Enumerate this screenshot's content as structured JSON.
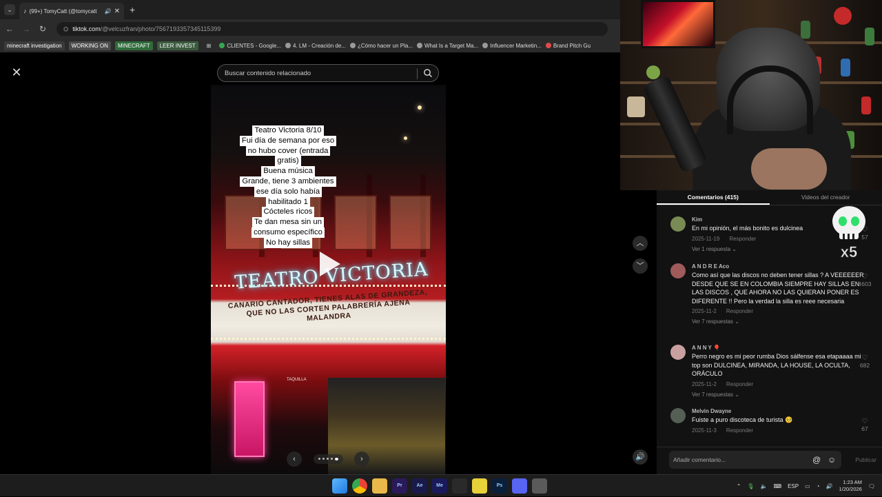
{
  "browser": {
    "tab": {
      "title": "(99+) TomyCatt (@tomycatt",
      "favicon": "tiktok"
    },
    "url": {
      "host": "tiktok.com",
      "path": "/@velcuzfran/photo/7567193357345115399"
    },
    "bookmarks": [
      {
        "label": "minecraft investigation",
        "type": "tag",
        "color": "#3a3a3a"
      },
      {
        "label": "WORKING ON",
        "type": "tag",
        "color": "#4a4a4a"
      },
      {
        "label": "MINECRAFT",
        "type": "tag",
        "color": "#2f6b3a"
      },
      {
        "label": "LEER INVEST",
        "type": "tag",
        "color": "#3b5a3e"
      },
      {
        "label": "CLIENTES - Google...",
        "type": "link",
        "color": "#34a853"
      },
      {
        "label": "4. LM - Creación de...",
        "type": "link",
        "color": "#9a9a9a"
      },
      {
        "label": "¿Cómo hacer un Pla...",
        "type": "link",
        "color": "#9a9a9a"
      },
      {
        "label": "What Is a Target Ma...",
        "type": "link",
        "color": "#9a9a9a"
      },
      {
        "label": "Influencer Marketin...",
        "type": "link",
        "color": "#9a9a9a"
      },
      {
        "label": "Brand Pitch Gu",
        "type": "link",
        "color": "#e24a4a"
      }
    ]
  },
  "search": {
    "placeholder": "Buscar contenido relacionado"
  },
  "photo": {
    "overlay_lines": [
      "Teatro Victoria 8/10",
      "Fui día de semana por eso",
      "no hubo cover (entrada",
      "gratis)",
      "Buena música",
      "Grande, tiene 3 ambientes",
      "ese día solo había",
      "habilitado 1",
      "Cócteles ricos",
      "Te dan mesa sin un",
      "consumo específico",
      "No hay sillas"
    ],
    "sign": "TEATRO VICTORIA",
    "marquee_lines": [
      "CANARIO CANTADOR, TIENES ALAS DE GRANDEZA,",
      "QUE NO LAS CORTEN PALABRERÍA AJENA",
      "MALANDRA"
    ],
    "door_label": "TAQUILLA",
    "carousel": {
      "count": 5,
      "active": 4
    }
  },
  "comments_panel": {
    "tabs": [
      "Comentarios (415)",
      "Videos del creador"
    ],
    "active_tab": 0,
    "reply_label": "Responder",
    "items": [
      {
        "name": "Kim",
        "text": "En mi opinión, el más bonito es dulcinea",
        "date": "2025-11-19",
        "replies": "Ver 1 respuesta",
        "likes": "57",
        "avatar_color": "#7a8a55"
      },
      {
        "name": "A N D R E Aco",
        "text": "Como así que las discos no deben tener sillas ? A VEEEEEER DESDE QUE SE EN COLOMBIA SIEMPRE HAY SILLAS EN LAS DISCOS , QUE AHORA NO LAS QUIERAN PONER ES DIFERENTE !! Pero la verdad la silla es reee necesaria",
        "date": "2025-11-2",
        "replies": "Ver 7 respuestas",
        "likes": "4603",
        "avatar_color": "#a05a5a"
      },
      {
        "name": "A N N Y 🎈",
        "text": "Perro negro es mi peor rumba Dios sálfense esa etapaaaa mi top son DULCINEA, MIRANDA, LA HOUSE, LA OCULTA, ORÁCULO",
        "date": "2025-11-2",
        "replies": "Ver 7 respuestas",
        "likes": "682",
        "avatar_color": "#c9a0a0"
      },
      {
        "name": "Melvin Dwayne",
        "text": "Fuiste a puro discoteca de turista 🥺",
        "date": "2025-11-3",
        "replies": "",
        "likes": "67",
        "avatar_color": "#555f55"
      }
    ],
    "comment_placeholder": "Añadir comentario...",
    "publish_label": "Publicar"
  },
  "overlay_badge": "x5",
  "taskbar": {
    "apps": [
      {
        "label": "",
        "name": "windows-start",
        "color": "#3aa0f0"
      },
      {
        "label": "",
        "name": "chrome",
        "color": "#e0a030"
      },
      {
        "label": "",
        "name": "file-explorer",
        "color": "#e8b84a"
      },
      {
        "label": "Pr",
        "name": "premiere",
        "color": "#2a1a5a"
      },
      {
        "label": "Ae",
        "name": "after-effects",
        "color": "#1a1a4a"
      },
      {
        "label": "Me",
        "name": "media-encoder",
        "color": "#1a1a5a"
      },
      {
        "label": "",
        "name": "obs",
        "color": "#2a2a2a"
      },
      {
        "label": "",
        "name": "sticky-notes",
        "color": "#e8d23a"
      },
      {
        "label": "Ps",
        "name": "photoshop",
        "color": "#0a1f3a"
      },
      {
        "label": "",
        "name": "discord",
        "color": "#5865f2"
      },
      {
        "label": "",
        "name": "settings",
        "color": "#5a5a5a"
      }
    ],
    "lang": "ESP",
    "time": "1:23 AM",
    "date": "1/20/2026"
  }
}
